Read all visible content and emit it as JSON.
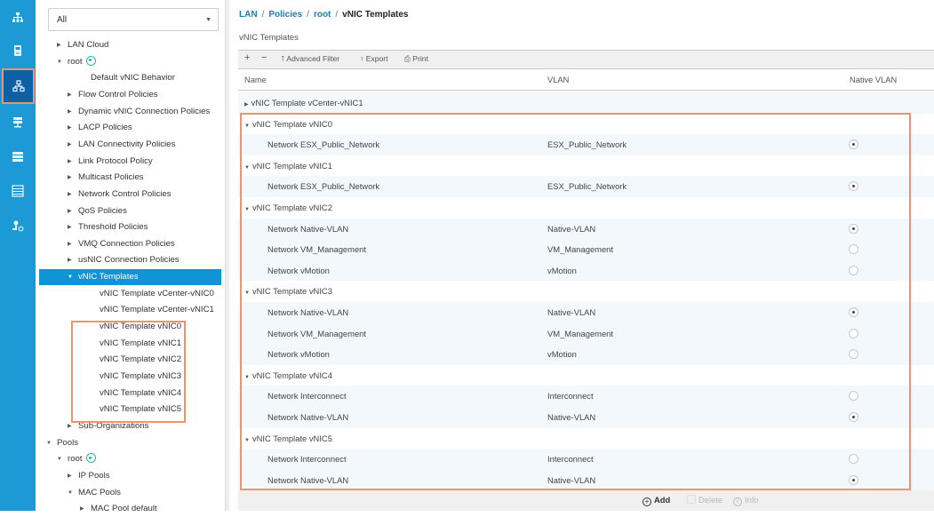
{
  "rail": {
    "icons": [
      {
        "name": "equipment-icon",
        "selected": false
      },
      {
        "name": "servers-icon",
        "selected": false
      },
      {
        "name": "lan-icon",
        "selected": true
      },
      {
        "name": "san-icon",
        "selected": false
      },
      {
        "name": "vm-icon",
        "selected": false
      },
      {
        "name": "storage-icon",
        "selected": false
      },
      {
        "name": "admin-icon",
        "selected": false
      }
    ]
  },
  "tree": {
    "filter": {
      "value": "All"
    },
    "nodes": [
      {
        "label": "LAN Cloud",
        "level": 1,
        "twisty": "collapsed"
      },
      {
        "label": "root",
        "level": 1,
        "twisty": "expanded",
        "org_icon": true
      },
      {
        "label": "Default vNIC Behavior",
        "level": 3,
        "twisty": "none"
      },
      {
        "label": "Flow Control Policies",
        "level": 2,
        "twisty": "collapsed"
      },
      {
        "label": "Dynamic vNIC Connection Policies",
        "level": 2,
        "twisty": "collapsed"
      },
      {
        "label": "LACP Policies",
        "level": 2,
        "twisty": "collapsed"
      },
      {
        "label": "LAN Connectivity Policies",
        "level": 2,
        "twisty": "collapsed"
      },
      {
        "label": "Link Protocol Policy",
        "level": 2,
        "twisty": "collapsed"
      },
      {
        "label": "Multicast Policies",
        "level": 2,
        "twisty": "collapsed"
      },
      {
        "label": "Network Control Policies",
        "level": 2,
        "twisty": "collapsed"
      },
      {
        "label": "QoS Policies",
        "level": 2,
        "twisty": "collapsed"
      },
      {
        "label": "Threshold Policies",
        "level": 2,
        "twisty": "collapsed"
      },
      {
        "label": "VMQ Connection Policies",
        "level": 2,
        "twisty": "collapsed"
      },
      {
        "label": "usNIC Connection Policies",
        "level": 2,
        "twisty": "collapsed"
      },
      {
        "label": "vNIC Templates",
        "level": 2,
        "twisty": "expanded",
        "selected": true
      },
      {
        "label": "vNIC Template vCenter-vNIC0",
        "level": 4,
        "twisty": "none"
      },
      {
        "label": "vNIC Template vCenter-vNIC1",
        "level": 4,
        "twisty": "none"
      },
      {
        "label": "vNIC Template vNIC0",
        "level": 4,
        "twisty": "none"
      },
      {
        "label": "vNIC Template vNIC1",
        "level": 4,
        "twisty": "none"
      },
      {
        "label": "vNIC Template vNIC2",
        "level": 4,
        "twisty": "none"
      },
      {
        "label": "vNIC Template vNIC3",
        "level": 4,
        "twisty": "none"
      },
      {
        "label": "vNIC Template vNIC4",
        "level": 4,
        "twisty": "none"
      },
      {
        "label": "vNIC Template vNIC5",
        "level": 4,
        "twisty": "none"
      },
      {
        "label": "Sub-Organizations",
        "level": 2,
        "twisty": "collapsed"
      },
      {
        "label": "Pools",
        "level": 0,
        "twisty": "expanded"
      },
      {
        "label": "root",
        "level": 1,
        "twisty": "expanded",
        "org_icon": true
      },
      {
        "label": "IP Pools",
        "level": 2,
        "twisty": "collapsed"
      },
      {
        "label": "MAC Pools",
        "level": 2,
        "twisty": "expanded"
      },
      {
        "label": "MAC Pool default",
        "level": 3,
        "twisty": "collapsed"
      }
    ]
  },
  "breadcrumb": {
    "items": [
      "LAN",
      "Policies",
      "root"
    ],
    "current": "vNIC Templates",
    "separator": "/"
  },
  "panel": {
    "title": "vNIC Templates",
    "toolbar": {
      "add": "+",
      "remove": "−",
      "filter": "Advanced Filter",
      "export": "Export",
      "print": "Print"
    },
    "columns": [
      "Name",
      "VLAN",
      "Native VLAN"
    ],
    "rows": [
      {
        "type": "group",
        "name": "vNIC Template vCenter-vNIC1",
        "expanded": false
      },
      {
        "type": "group",
        "name": "vNIC Template vNIC0",
        "expanded": true
      },
      {
        "type": "child",
        "name": "Network ESX_Public_Network",
        "vlan": "ESX_Public_Network",
        "native": true
      },
      {
        "type": "group",
        "name": "vNIC Template vNIC1",
        "expanded": true
      },
      {
        "type": "child",
        "name": "Network ESX_Public_Network",
        "vlan": "ESX_Public_Network",
        "native": true
      },
      {
        "type": "group",
        "name": "vNIC Template vNIC2",
        "expanded": true
      },
      {
        "type": "child",
        "name": "Network Native-VLAN",
        "vlan": "Native-VLAN",
        "native": true
      },
      {
        "type": "child",
        "name": "Network VM_Management",
        "vlan": "VM_Management",
        "native": false
      },
      {
        "type": "child",
        "name": "Network vMotion",
        "vlan": "vMotion",
        "native": false
      },
      {
        "type": "group",
        "name": "vNIC Template vNIC3",
        "expanded": true
      },
      {
        "type": "child",
        "name": "Network Native-VLAN",
        "vlan": "Native-VLAN",
        "native": true
      },
      {
        "type": "child",
        "name": "Network VM_Management",
        "vlan": "VM_Management",
        "native": false
      },
      {
        "type": "child",
        "name": "Network vMotion",
        "vlan": "vMotion",
        "native": false
      },
      {
        "type": "group",
        "name": "vNIC Template vNIC4",
        "expanded": true
      },
      {
        "type": "child",
        "name": "Network Interconnect",
        "vlan": "Interconnect",
        "native": false
      },
      {
        "type": "child",
        "name": "Network Native-VLAN",
        "vlan": "Native-VLAN",
        "native": true
      },
      {
        "type": "group",
        "name": "vNIC Template vNIC5",
        "expanded": true
      },
      {
        "type": "child",
        "name": "Network Interconnect",
        "vlan": "Interconnect",
        "native": false
      },
      {
        "type": "child",
        "name": "Network Native-VLAN",
        "vlan": "Native-VLAN",
        "native": true
      }
    ],
    "footer": {
      "add": "Add",
      "delete": "Delete",
      "info": "Info"
    }
  },
  "colors": {
    "rail": "#1b9ad6",
    "rail_selected": "#0d5fa6",
    "tree_selected": "#0f95d6",
    "highlight_box": "#e99670",
    "link": "#1c7db5"
  }
}
